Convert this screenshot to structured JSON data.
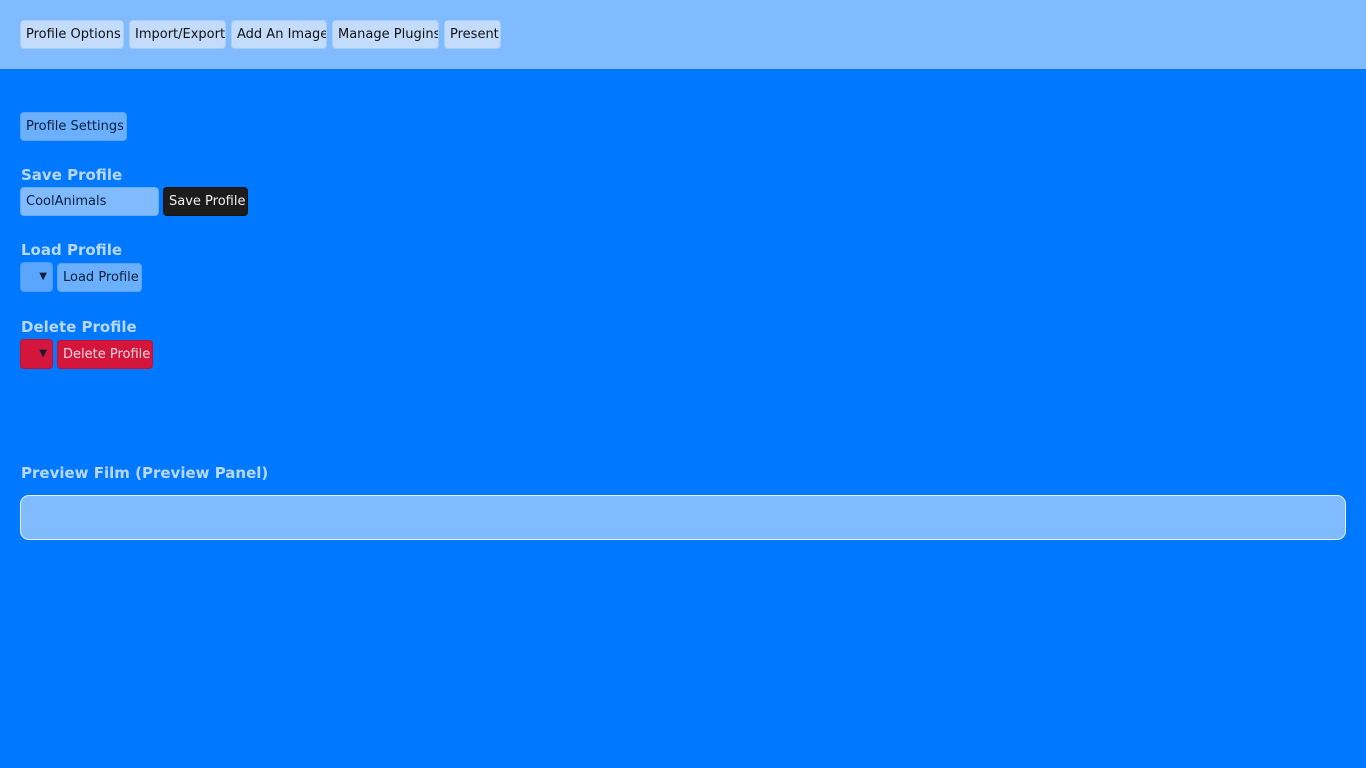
{
  "nav": {
    "items": [
      {
        "label": "Profile Options"
      },
      {
        "label": "Import/Export"
      },
      {
        "label": "Add An Image"
      },
      {
        "label": "Manage Plugins"
      },
      {
        "label": "Present"
      }
    ]
  },
  "profile_settings": {
    "tab_label": "Profile Settings"
  },
  "save_section": {
    "title": "Save Profile",
    "input_value": "CoolAnimals",
    "button_label": "Save Profile"
  },
  "load_section": {
    "title": "Load Profile",
    "select_value": "",
    "button_label": "Load Profile"
  },
  "delete_section": {
    "title": "Delete Profile",
    "select_value": "",
    "button_label": "Delete Profile"
  },
  "preview": {
    "title": "Preview Film (Preview Panel)"
  },
  "icons": {
    "dropdown": "chevron-down-icon"
  },
  "colors": {
    "page_bg": "#0078ff",
    "topbar_bg": "#80bbff",
    "danger": "#d4163c",
    "dark_button": "#1c1c1c"
  }
}
